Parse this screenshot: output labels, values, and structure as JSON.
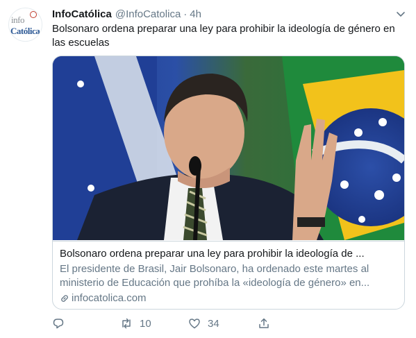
{
  "tweet": {
    "author_name": "InfoCatólica",
    "author_handle": "@InfoCatolica",
    "separator": "·",
    "time": "4h",
    "text": "Bolsonaro ordena preparar una ley para prohibir la ideología de género en las escuelas",
    "avatar_logo_top": "info",
    "avatar_logo_bottom": "Católica"
  },
  "card": {
    "title": "Bolsonaro ordena preparar una ley para prohibir la ideología de ...",
    "description": "El presidente de Brasil, Jair Bolsonaro, ha ordenado este martes al ministerio de Educación que prohíba la «ideología de género» en...",
    "domain": "infocatolica.com"
  },
  "actions": {
    "reply_count": "",
    "retweet_count": "10",
    "like_count": "34"
  },
  "icons": {
    "caret": "chevron-down-icon",
    "link": "link-icon",
    "reply": "reply-icon",
    "retweet": "retweet-icon",
    "like": "heart-icon",
    "share": "share-icon"
  },
  "colors": {
    "text": "#14171a",
    "secondary": "#657786",
    "border": "#ccd6dd"
  }
}
